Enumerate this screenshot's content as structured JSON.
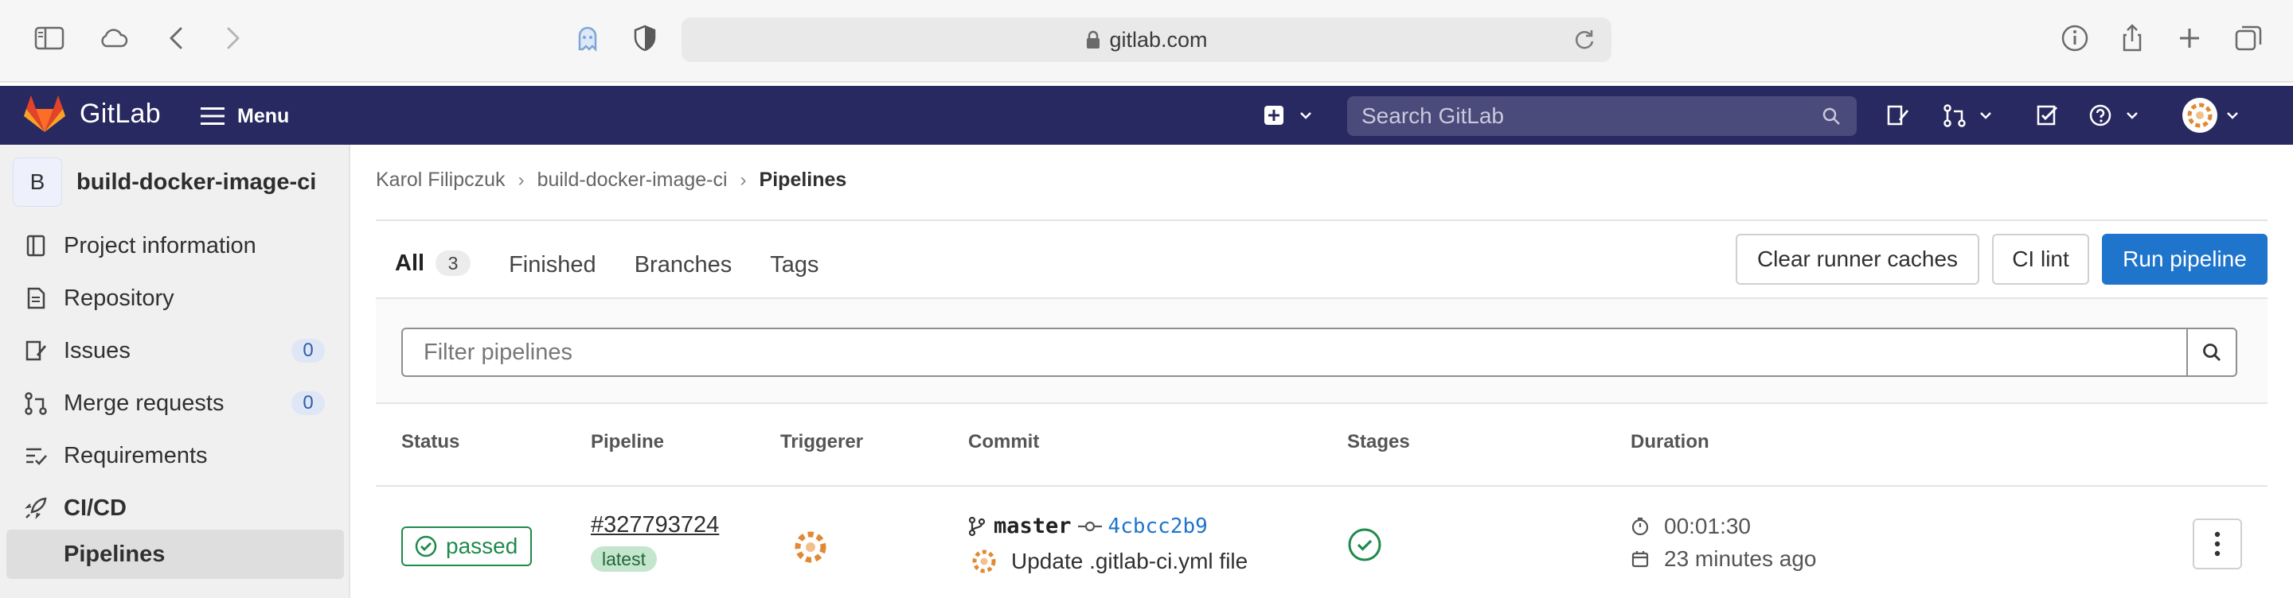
{
  "browser": {
    "url": "gitlab.com",
    "icons": [
      "sidebar-toggle-icon",
      "cloud-icon",
      "back-icon",
      "forward-icon",
      "ghost-extension-icon",
      "shield-icon",
      "reload-icon",
      "info-icon",
      "share-icon",
      "new-tab-icon",
      "tabs-overview-icon"
    ]
  },
  "topnav": {
    "brand": "GitLab",
    "menu_label": "Menu",
    "search_placeholder": "Search GitLab",
    "bg_color": "#292961"
  },
  "sidebar": {
    "project_initial": "B",
    "project_name": "build-docker-image-ci",
    "items": [
      {
        "label": "Project information",
        "icon": "project-info-icon"
      },
      {
        "label": "Repository",
        "icon": "repository-icon"
      },
      {
        "label": "Issues",
        "icon": "issues-icon",
        "count": "0"
      },
      {
        "label": "Merge requests",
        "icon": "merge-request-icon",
        "count": "0"
      },
      {
        "label": "Requirements",
        "icon": "requirements-icon"
      },
      {
        "label": "CI/CD",
        "icon": "rocket-icon"
      }
    ],
    "sub_item": "Pipelines"
  },
  "breadcrumb": [
    "Karol Filipczuk",
    "build-docker-image-ci",
    "Pipelines"
  ],
  "tabs": [
    {
      "label": "All",
      "count": "3",
      "active": true
    },
    {
      "label": "Finished"
    },
    {
      "label": "Branches"
    },
    {
      "label": "Tags"
    }
  ],
  "actions": {
    "clear_caches": "Clear runner caches",
    "ci_lint": "CI lint",
    "run_pipeline": "Run pipeline"
  },
  "filter": {
    "placeholder": "Filter pipelines"
  },
  "table": {
    "headers": [
      "Status",
      "Pipeline",
      "Triggerer",
      "Commit",
      "Stages",
      "Duration"
    ],
    "rows": [
      {
        "status": "passed",
        "pipeline_id": "#327793724",
        "tag": "latest",
        "branch": "master",
        "sha": "4cbcc2b9",
        "commit_message": "Update .gitlab-ci.yml file",
        "duration": "00:01:30",
        "finished": "23 minutes ago"
      }
    ]
  },
  "colors": {
    "accent": "#1f75cb",
    "success": "#1f8a4c",
    "tab_underline": "#6b6bd6"
  }
}
